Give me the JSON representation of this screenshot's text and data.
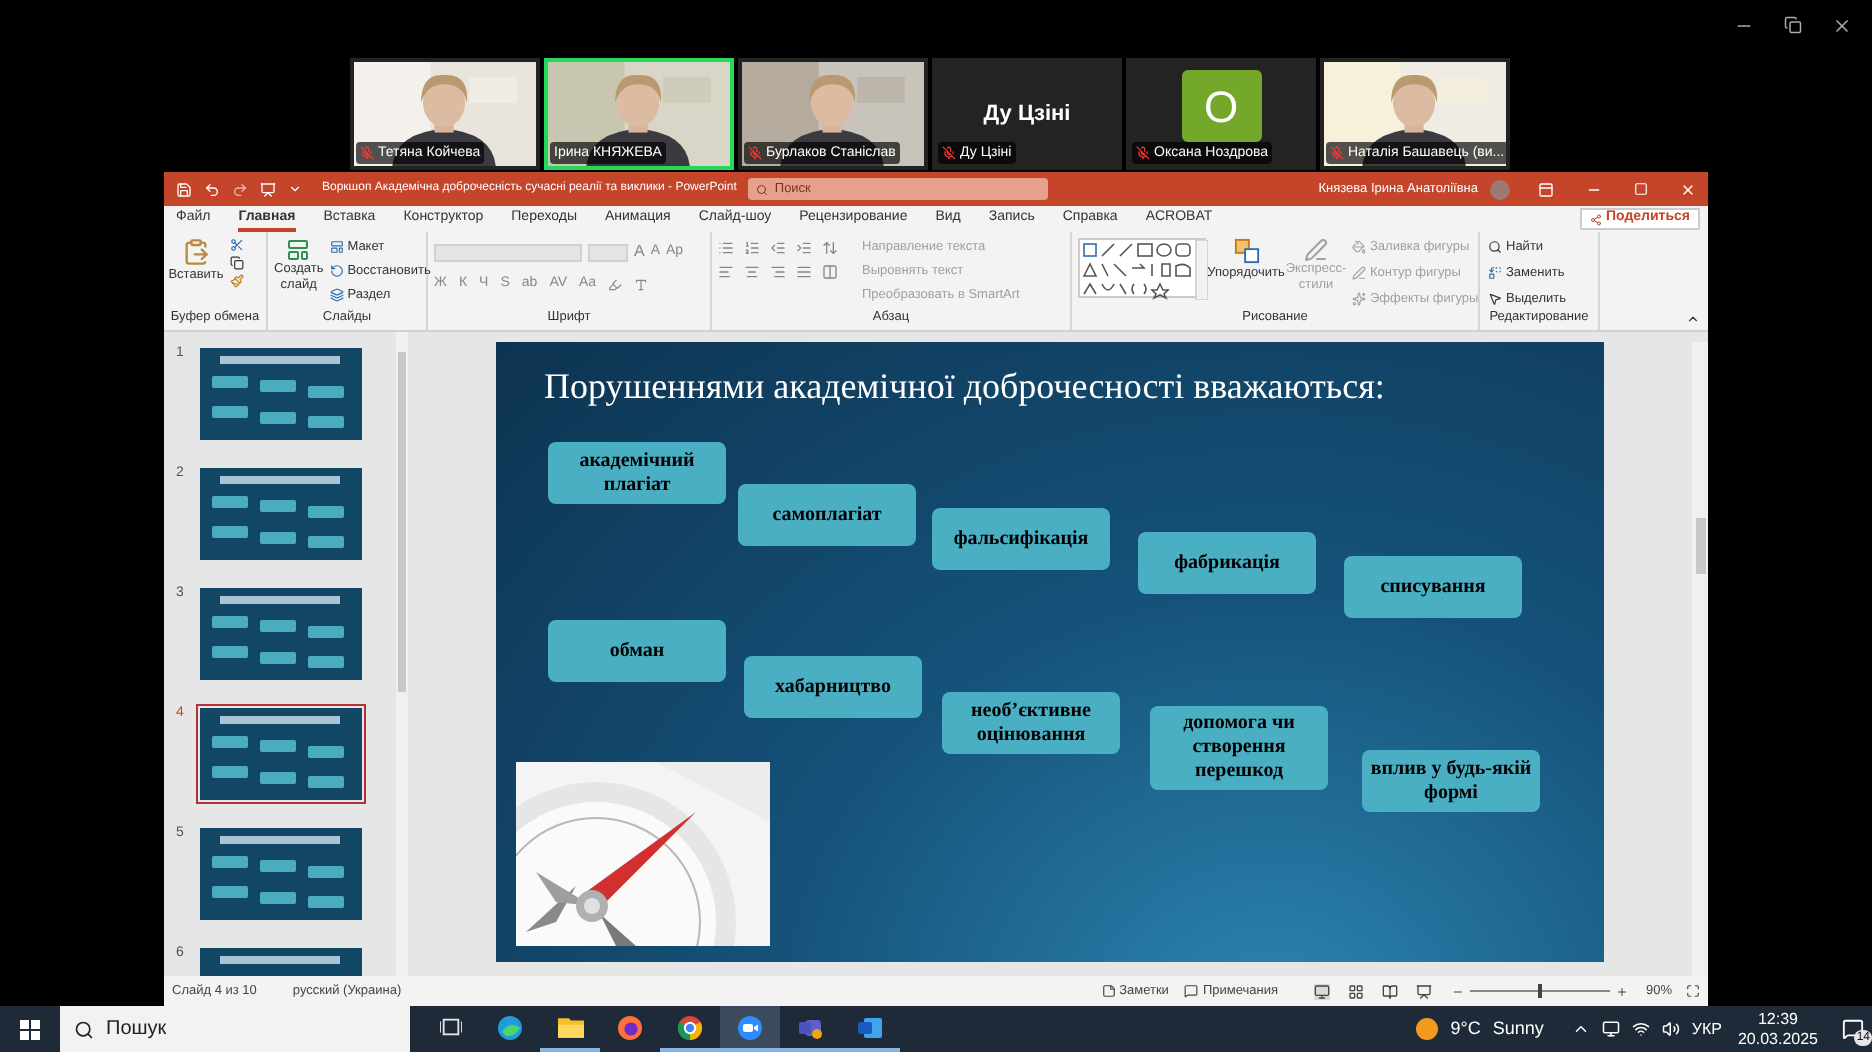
{
  "meeting": {
    "participants": [
      {
        "name": "Тетяна Койчева",
        "kind": "video",
        "muted": true,
        "active": false
      },
      {
        "name": "Ірина КНЯЖЕВА",
        "kind": "video",
        "muted": false,
        "active": true
      },
      {
        "name": "Бурлаков Станіслав",
        "kind": "video",
        "muted": true,
        "active": false
      },
      {
        "name": "Ду Цзіні",
        "kind": "name",
        "display": "Ду Цзіні",
        "muted": true,
        "active": false
      },
      {
        "name": "Оксана Ноздрова",
        "kind": "avatar",
        "initial": "О",
        "muted": true,
        "active": false
      },
      {
        "name": "Наталія Башавець (ви...",
        "kind": "video",
        "muted": true,
        "active": false
      }
    ]
  },
  "powerpoint": {
    "title": "Воркшоп Академічна доброчесність сучасні реалії та виклики  -  PowerPoint",
    "search_placeholder": "Поиск",
    "user": "Князева Ірина Анатоліївна",
    "tabs": [
      {
        "label": "Файл",
        "selected": false
      },
      {
        "label": "Главная",
        "selected": true
      },
      {
        "label": "Вставка",
        "selected": false
      },
      {
        "label": "Конструктор",
        "selected": false
      },
      {
        "label": "Переходы",
        "selected": false
      },
      {
        "label": "Анимация",
        "selected": false
      },
      {
        "label": "Слайд-шоу",
        "selected": false
      },
      {
        "label": "Рецензирование",
        "selected": false
      },
      {
        "label": "Вид",
        "selected": false
      },
      {
        "label": "Запись",
        "selected": false
      },
      {
        "label": "Справка",
        "selected": false
      },
      {
        "label": "ACROBAT",
        "selected": false
      }
    ],
    "share_button": "Поделиться",
    "ribbon": {
      "clipboard": {
        "label": "Буфер обмена",
        "paste": "Вставить"
      },
      "slides": {
        "label": "Слайды",
        "new_slide": "Создать слайд",
        "layout": "Макет",
        "reset": "Восстановить",
        "section": "Раздел"
      },
      "font": {
        "label": "Шрифт",
        "buttons": [
          "Ж",
          "К",
          "Ч",
          "S",
          "ab",
          "AV",
          "Aa"
        ],
        "grow": "A",
        "shrink": "A",
        "clear": "Ap"
      },
      "paragraph": {
        "label": "Абзац",
        "commands": [
          {
            "text": "Направление текста",
            "disabled": true
          },
          {
            "text": "Выровнять текст",
            "disabled": true
          },
          {
            "text": "Преобразовать в SmartArt",
            "disabled": true
          }
        ]
      },
      "drawing": {
        "label": "Рисование",
        "arrange": "Упорядочить",
        "quick_styles": {
          "text": "Экспресс-стили",
          "disabled": true
        },
        "commands": [
          {
            "text": "Заливка фигуры",
            "disabled": true
          },
          {
            "text": "Контур фигуры",
            "disabled": true
          },
          {
            "text": "Эффекты фигуры",
            "disabled": true
          }
        ]
      },
      "editing": {
        "label": "Редактирование",
        "commands": [
          "Найти",
          "Заменить",
          "Выделить"
        ]
      }
    },
    "thumbnails": [
      {
        "number": "1",
        "selected": false
      },
      {
        "number": "2",
        "selected": false
      },
      {
        "number": "3",
        "selected": false
      },
      {
        "number": "4",
        "selected": true
      },
      {
        "number": "5",
        "selected": false
      },
      {
        "number": "6",
        "selected": false
      }
    ],
    "slide": {
      "title": "Порушеннями академічної доброчесності вважаються:",
      "boxes": [
        {
          "text": "академічний плагіат"
        },
        {
          "text": "самоплагіат"
        },
        {
          "text": "фальсифікація"
        },
        {
          "text": "фабрикація"
        },
        {
          "text": "списування"
        },
        {
          "text": "обман"
        },
        {
          "text": "хабарництво"
        },
        {
          "text": "необ’єктивне оцінювання"
        },
        {
          "text": "допомога чи створення перешкод"
        },
        {
          "text": "вплив у будь-якій формі"
        }
      ]
    },
    "status_bar": {
      "slide_info": "Слайд 4 из 10",
      "language": "русский (Украина)",
      "notes": "Заметки",
      "comments": "Примечания",
      "zoom": {
        "level": 0.5
      },
      "zoom_text": "90%"
    }
  },
  "taskbar": {
    "search_placeholder": "Пошук",
    "apps": [
      {
        "kind": "taskview",
        "running": false,
        "active": false
      },
      {
        "kind": "edge",
        "running": false,
        "active": false
      },
      {
        "kind": "explorer",
        "running": true,
        "active": false
      },
      {
        "kind": "firefox",
        "running": false,
        "active": false
      },
      {
        "kind": "chrome",
        "running": true,
        "active": false
      },
      {
        "kind": "zoom",
        "running": true,
        "active": true
      },
      {
        "kind": "teams",
        "running": true,
        "active": false
      },
      {
        "kind": "word",
        "running": true,
        "active": false
      }
    ],
    "temperature": "9°C",
    "weather": "Sunny",
    "language": "УКР",
    "time": "12:39",
    "date": "20.03.2025",
    "notifications": "14"
  }
}
